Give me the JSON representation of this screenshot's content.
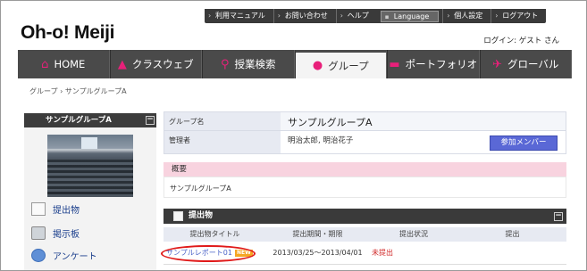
{
  "util_links": [
    "利用マニュアル",
    "お問い合わせ",
    "ヘルプ",
    "Language",
    "個人設定",
    "ログアウト"
  ],
  "logo": "Oh-o! Meiji",
  "login_text": "ログイン:  ゲスト さん",
  "nav": [
    {
      "icon": "home-icon",
      "glyph": "⌂",
      "label": "HOME"
    },
    {
      "icon": "graduation-cap-icon",
      "glyph": "▲",
      "label": "クラスウェブ"
    },
    {
      "icon": "search-icon",
      "glyph": "⚲",
      "label": "授業検索"
    },
    {
      "icon": "group-icon",
      "glyph": "●",
      "label": "グループ"
    },
    {
      "icon": "folder-icon",
      "glyph": "▬",
      "label": "ポートフォリオ"
    },
    {
      "icon": "airplane-icon",
      "glyph": "✈",
      "label": "グローバル"
    }
  ],
  "breadcrumb": "グループ › サンプルグループA",
  "sidebar": {
    "title": "サンプルグループA",
    "toggle": "−",
    "links": [
      "提出物",
      "掲示板",
      "アンケート"
    ]
  },
  "group": {
    "name_label": "グループ名",
    "name_value": "サンプルグループA",
    "admin_label": "管理者",
    "admin_value": "明治太郎, 明治花子",
    "member_button": "参加メンバー",
    "overview_label": "概要",
    "overview_value": "サンプルグループA"
  },
  "submissions": {
    "title": "提出物",
    "toggle": "−",
    "columns": [
      "提出物タイトル",
      "提出期間・期限",
      "提出状況",
      "提出"
    ],
    "rows": [
      {
        "title": "サンプルレポート01",
        "badge": "NEW",
        "period": "2013/03/25〜2013/04/01",
        "status": "未提出",
        "submit": ""
      }
    ]
  },
  "colors": {
    "nav_bg": "#4a4a4a",
    "accent_pink": "#e8207a",
    "button_blue": "#5a68d6",
    "status_red": "#d12a2a",
    "highlight_ring": "#e01919"
  }
}
